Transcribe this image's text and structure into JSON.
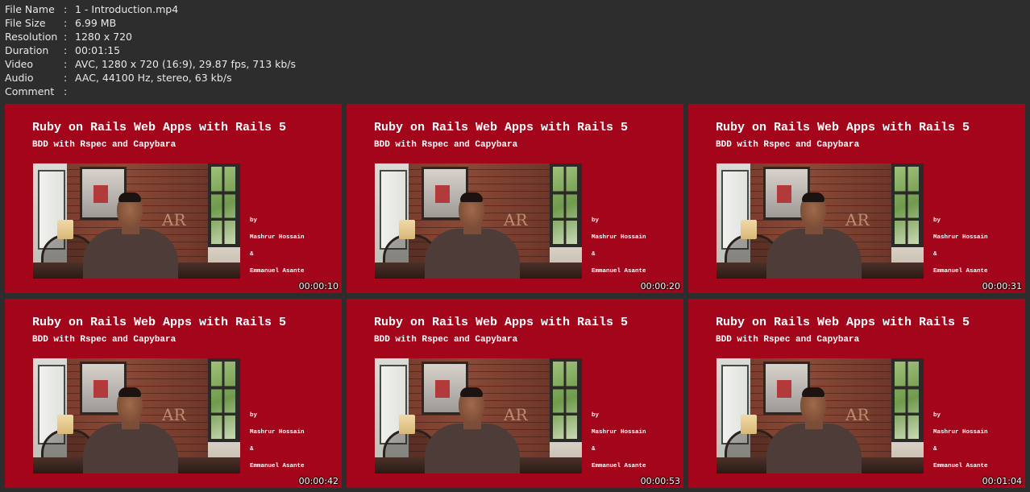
{
  "file_info": {
    "separator": ":",
    "rows": [
      {
        "key": "File Name",
        "value": "1 - Introduction.mp4"
      },
      {
        "key": "File Size",
        "value": "6.99 MB"
      },
      {
        "key": "Resolution",
        "value": "1280 x 720"
      },
      {
        "key": "Duration",
        "value": "00:01:15"
      },
      {
        "key": "Video",
        "value": "AVC, 1280 x 720 (16:9), 29.87 fps, 713 kb/s"
      },
      {
        "key": "Audio",
        "value": "AAC, 44100 Hz, stereo, 63 kb/s"
      },
      {
        "key": "Comment",
        "value": ""
      }
    ]
  },
  "thumbnails": [
    {
      "title": "Ruby on Rails Web Apps with Rails 5",
      "subtitle": "BDD with Rspec and Capybara",
      "by": "by",
      "author1": "Mashrur Hossain",
      "amp": "&",
      "author2": "Emmanuel Asante",
      "photo_letters": "AR",
      "timestamp": "00:00:10"
    },
    {
      "title": "Ruby on Rails Web Apps with Rails 5",
      "subtitle": "BDD with Rspec and Capybara",
      "by": "by",
      "author1": "Mashrur Hossain",
      "amp": "&",
      "author2": "Emmanuel Asante",
      "photo_letters": "AR",
      "timestamp": "00:00:20"
    },
    {
      "title": "Ruby on Rails Web Apps with Rails 5",
      "subtitle": "BDD with Rspec and Capybara",
      "by": "by",
      "author1": "Mashrur Hossain",
      "amp": "&",
      "author2": "Emmanuel Asante",
      "photo_letters": "AR",
      "timestamp": "00:00:31"
    },
    {
      "title": "Ruby on Rails Web Apps with Rails 5",
      "subtitle": "BDD with Rspec and Capybara",
      "by": "by",
      "author1": "Mashrur Hossain",
      "amp": "&",
      "author2": "Emmanuel Asante",
      "photo_letters": "AR",
      "timestamp": "00:00:42"
    },
    {
      "title": "Ruby on Rails Web Apps with Rails 5",
      "subtitle": "BDD with Rspec and Capybara",
      "by": "by",
      "author1": "Mashrur Hossain",
      "amp": "&",
      "author2": "Emmanuel Asante",
      "photo_letters": "AR",
      "timestamp": "00:00:53"
    },
    {
      "title": "Ruby on Rails Web Apps with Rails 5",
      "subtitle": "BDD with Rspec and Capybara",
      "by": "by",
      "author1": "Mashrur Hossain",
      "amp": "&",
      "author2": "Emmanuel Asante",
      "photo_letters": "AR",
      "timestamp": "00:01:04"
    }
  ],
  "colors": {
    "background": "#2d2d2d",
    "slide_red": "#a3061a",
    "text": "#e8e8e8"
  }
}
